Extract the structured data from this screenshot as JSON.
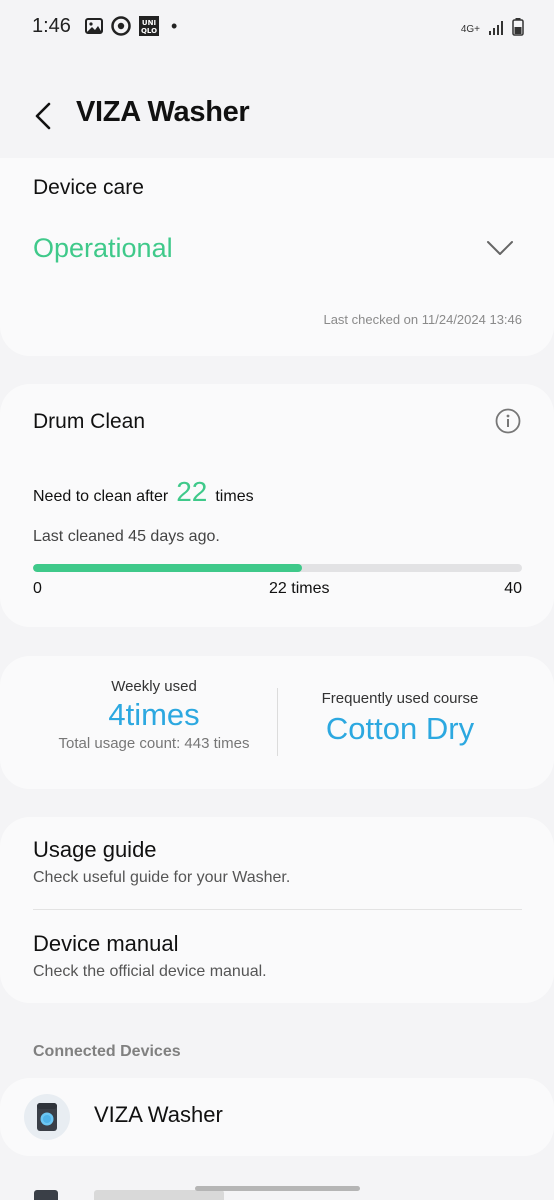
{
  "status_bar": {
    "time": "1:46",
    "notification_icons": [
      "gallery-icon",
      "chrome-icon",
      "uniqlo-icon"
    ],
    "dot": "•",
    "network": "4G+",
    "uniqlo_top": "UNI",
    "uniqlo_bottom": "QLO"
  },
  "header": {
    "title": "VIZA Washer"
  },
  "device_care": {
    "title": "Device care",
    "status": "Operational",
    "last_checked": "Last checked on 11/24/2024 13:46"
  },
  "drum_clean": {
    "title": "Drum Clean",
    "need_prefix": "Need to clean after",
    "need_count": "22",
    "need_suffix": "times",
    "last_cleaned": "Last cleaned 45 days ago.",
    "progress_fraction": 0.55,
    "scale_min": "0",
    "scale_mid": "22 times",
    "scale_max": "40"
  },
  "usage_stats": {
    "weekly_label": "Weekly used",
    "weekly_value": "4times",
    "total_usage": "Total usage count: 443 times",
    "course_label": "Frequently used course",
    "course_value": "Cotton Dry"
  },
  "guides": [
    {
      "title": "Usage guide",
      "subtitle": "Check useful guide for your Washer."
    },
    {
      "title": "Device manual",
      "subtitle": "Check the official device manual."
    }
  ],
  "connected": {
    "section_title": "Connected Devices",
    "devices": [
      {
        "name": "VIZA Washer",
        "icon": "washer-icon"
      }
    ]
  },
  "colors": {
    "accent_green": "#3fc98a",
    "accent_blue": "#2ca8e0",
    "background": "#f4f4f6",
    "card": "#fafafb"
  }
}
